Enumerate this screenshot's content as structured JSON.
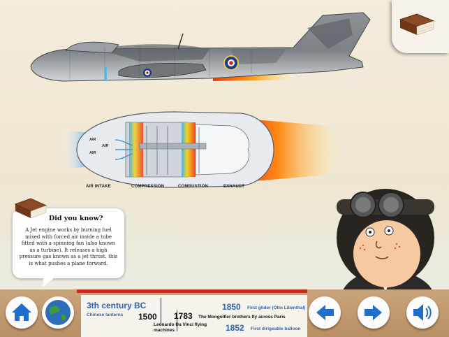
{
  "diagram": {
    "air_labels": [
      "AIR",
      "AIR",
      "AIR"
    ],
    "stage_labels": [
      "AIR INTAKE",
      "COMPRESSION",
      "COMBUSTION",
      "EXHAUST"
    ]
  },
  "did_you_know": {
    "title": "Did you know?",
    "text": "A Jet engine works by burning fuel mixed with forced air inside a tube fitted with a spinning fan (also known as a turbine). It releases a high pressure gas known as a jet thrust. this is what pushes a plane forward."
  },
  "timeline": {
    "entries": [
      {
        "year": "3th century BC",
        "caption": "Chinese lanterns"
      },
      {
        "year": "1500",
        "caption": "Leonardo Da Vinci flying machines"
      },
      {
        "year": "1783",
        "caption": "The Mongolfier brothers fly across Paris"
      },
      {
        "year": "1850",
        "caption": "First glider (Otto Lilienthal)"
      },
      {
        "year": "1852",
        "caption": "First dirigeable balloon"
      }
    ]
  },
  "colors": {
    "accent_blue": "#2f64ad",
    "timeline_red": "#c62b1f",
    "wood": "#c9a47a"
  },
  "icons": {
    "home": "home-icon",
    "globe": "globe-icon",
    "back": "arrow-left-icon",
    "forward": "arrow-right-icon",
    "sound": "speaker-icon",
    "book": "book-icon"
  }
}
